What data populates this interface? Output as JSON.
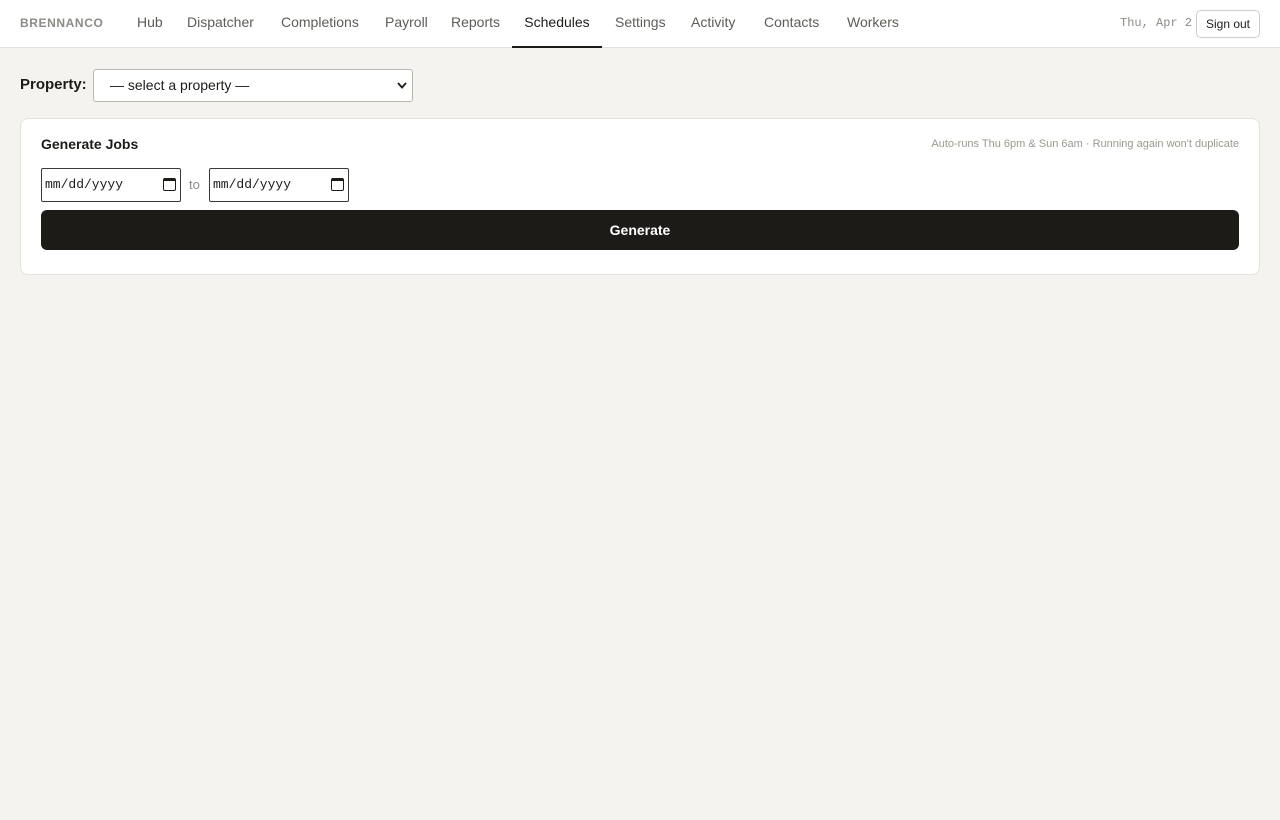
{
  "header": {
    "brand": "BRENNANCO",
    "tabs": [
      {
        "label": "Hub",
        "active": false
      },
      {
        "label": "Dispatcher",
        "active": false
      },
      {
        "label": "Completions",
        "active": false
      },
      {
        "label": "Payroll",
        "active": false
      },
      {
        "label": "Reports",
        "active": false
      },
      {
        "label": "Schedules",
        "active": true
      },
      {
        "label": "Settings",
        "active": false
      },
      {
        "label": "Activity",
        "active": false
      },
      {
        "label": "Contacts",
        "active": false
      },
      {
        "label": "Workers",
        "active": false
      }
    ],
    "date": "Thu, Apr 2",
    "sign_out_label": "Sign out"
  },
  "property": {
    "label": "Property:",
    "selected": "— select a property —"
  },
  "generate_jobs": {
    "title": "Generate Jobs",
    "note": "Auto-runs Thu 6pm & Sun 6am · Running again won't duplicate",
    "start_date_placeholder": "mm/dd/yyyy",
    "to_label": "to",
    "end_date_placeholder": "mm/dd/yyyy",
    "button_label": "Generate"
  },
  "icons": {
    "select_chevron": "chevron-down-icon",
    "date_picker": "calendar-icon"
  }
}
